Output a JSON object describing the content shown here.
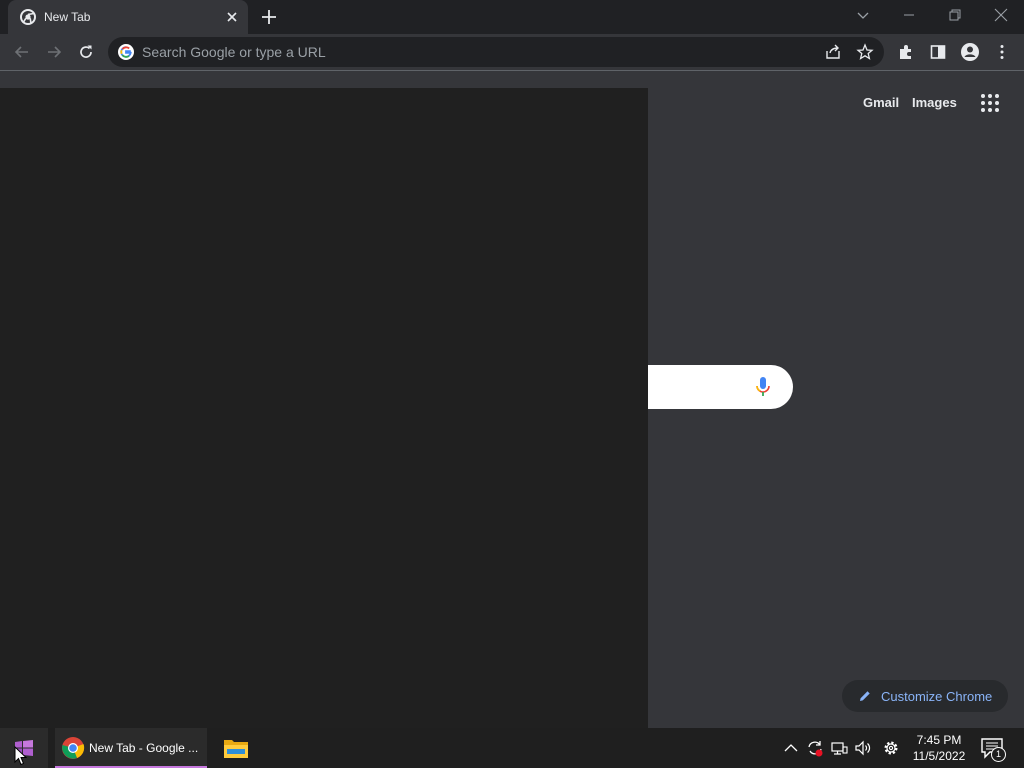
{
  "tab": {
    "title": "New Tab",
    "favicon": "chrome-icon"
  },
  "window_controls": [
    "dropdown-icon",
    "minimize-icon",
    "restore-icon",
    "close-icon"
  ],
  "toolbar": {
    "back_icon": "back-arrow-icon",
    "forward_icon": "forward-arrow-icon",
    "reload_icon": "reload-icon",
    "omnibox_placeholder": "Search Google or type a URL",
    "omnibox_value": "",
    "right_icons": [
      "share-icon",
      "star-icon",
      "extensions-icon",
      "side-panel-icon",
      "profile-icon",
      "more-icon"
    ]
  },
  "page": {
    "links": {
      "gmail": "Gmail",
      "images": "Images"
    },
    "customize_label": "Customize Chrome"
  },
  "taskbar": {
    "chrome_label": "New Tab - Google ...",
    "clock_time": "7:45 PM",
    "clock_date": "11/5/2022",
    "notification_count": "1"
  },
  "colors": {
    "accent_link": "#8ab4f8",
    "toolbar_bg": "#35363a",
    "tabstrip_bg": "#202124",
    "taskbar_active_underline": "#c678dd"
  }
}
